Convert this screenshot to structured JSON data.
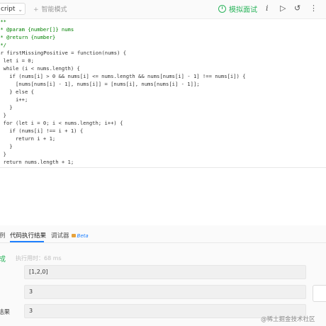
{
  "toolbar": {
    "language": "cript",
    "smart_mode": "智能模式",
    "interview_label": "模拟面试",
    "info_icon": "i",
    "run_icon": "▷",
    "reset_icon": "↺",
    "more_icon": "⋮"
  },
  "code_lines": [
    "/**",
    " * @param {number[]} nums",
    " * @return {number}",
    " */",
    "var firstMissingPositive = function(nums) {",
    "  let i = 0;",
    "  while (i < nums.length) {",
    "    if (nums[i] > 0 && nums[i] <= nums.length && nums[nums[i] - 1] !== nums[i]) {",
    "      [nums[nums[i] - 1], nums[i]] = [nums[i], nums[nums[i] - 1]];",
    "    } else {",
    "      i++;",
    "    }",
    "  }",
    "  for (let i = 0; i < nums.length; i++) {",
    "    if (nums[i] !== i + 1) {",
    "      return i + 1;",
    "    }",
    "  }",
    "  return nums.length + 1;",
    "};"
  ],
  "panel": {
    "tab_left": "例",
    "tab_result": "代码执行结果",
    "tab_debugger": "调试器",
    "tab_beta": "Beta",
    "status": "成",
    "exec_time": "执行用时：68 ms",
    "input_value": "[1,2,0]",
    "output_value": "3",
    "expected_label": "结果",
    "expected_value": "3"
  },
  "watermark": "@稀土掘金技术社区",
  "colors": {
    "accent_green": "#2db55d",
    "accent_blue": "#1e80ff",
    "keyword": "#0000ff",
    "comment": "#008000"
  }
}
